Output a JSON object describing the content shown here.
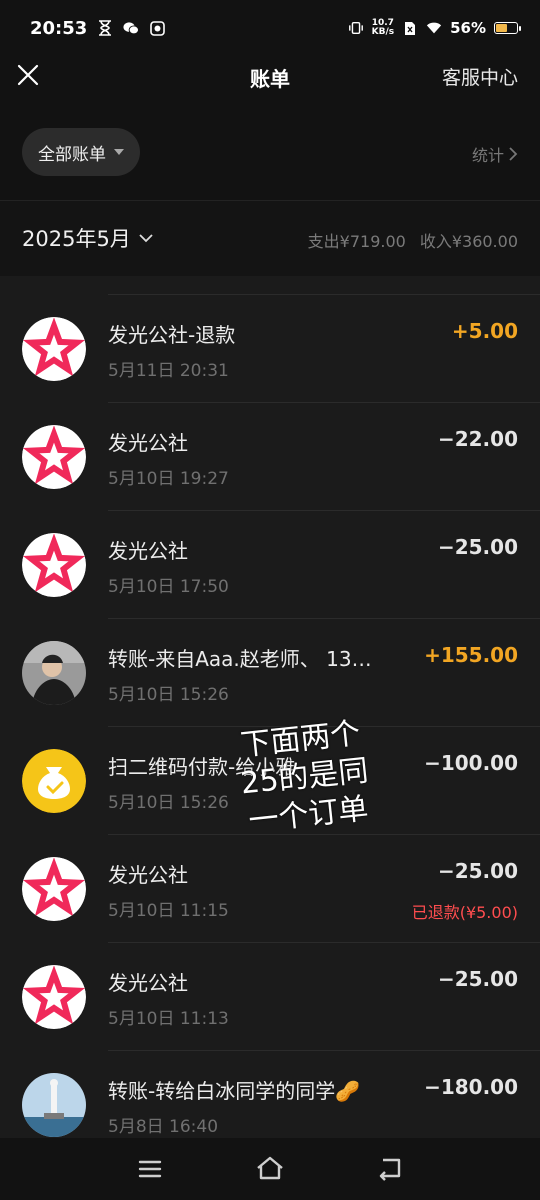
{
  "status_bar": {
    "time": "20:53",
    "net_speed_top": "10.7",
    "net_speed_unit": "KB/s",
    "battery_percent": "56%",
    "battery_level": 0.56,
    "left_icons": [
      "hourglass-icon",
      "wechat-icon",
      "gallery-icon"
    ],
    "right_icons": [
      "vibrate-icon",
      "sim-off-icon",
      "wifi-icon",
      "battery-icon"
    ]
  },
  "header": {
    "title": "账单",
    "service_label": "客服中心",
    "close_icon": "close-icon"
  },
  "filter": {
    "all_bills_label": "全部账单",
    "stats_label": "统计"
  },
  "month": {
    "label": "2025年5月",
    "expense": "支出¥719.00",
    "income": "收入¥360.00"
  },
  "transactions": [
    {
      "title": "发光公社-退款",
      "time": "5月11日 20:31",
      "amount": "+5.00",
      "icon": "star-logo-icon",
      "note": ""
    },
    {
      "title": "发光公社",
      "time": "5月10日 19:27",
      "amount": "−22.00",
      "icon": "star-logo-icon",
      "note": ""
    },
    {
      "title": "发光公社",
      "time": "5月10日 17:50",
      "amount": "−25.00",
      "icon": "star-logo-icon",
      "note": ""
    },
    {
      "title": "转账-来自Aaa.赵老师、 13…",
      "time": "5月10日 15:26",
      "amount": "+155.00",
      "icon": "person-avatar-icon",
      "note": ""
    },
    {
      "title": "扫二维码付款-给小雅",
      "time": "5月10日 15:26",
      "amount": "−100.00",
      "icon": "money-bag-icon",
      "note": ""
    },
    {
      "title": "发光公社",
      "time": "5月10日 11:15",
      "amount": "−25.00",
      "icon": "star-logo-icon",
      "note": "已退款(¥5.00)"
    },
    {
      "title": "发光公社",
      "time": "5月10日 11:13",
      "amount": "−25.00",
      "icon": "star-logo-icon",
      "note": ""
    },
    {
      "title": "转账-转给白冰同学的同学🥜",
      "time": "5月8日 16:40",
      "amount": "−180.00",
      "icon": "statue-avatar-icon",
      "note": ""
    }
  ],
  "annotation": {
    "line1": "下面两个",
    "line2": "25的是同",
    "line3": "一个订单"
  },
  "colors": {
    "background": "#1b1b1b",
    "income": "#f2a623",
    "refund_note": "#ff4d4f",
    "brand_red": "#f0295a",
    "money_bag_yellow": "#f5c518"
  },
  "nav_icons": [
    "menu-icon",
    "home-icon",
    "back-icon"
  ]
}
